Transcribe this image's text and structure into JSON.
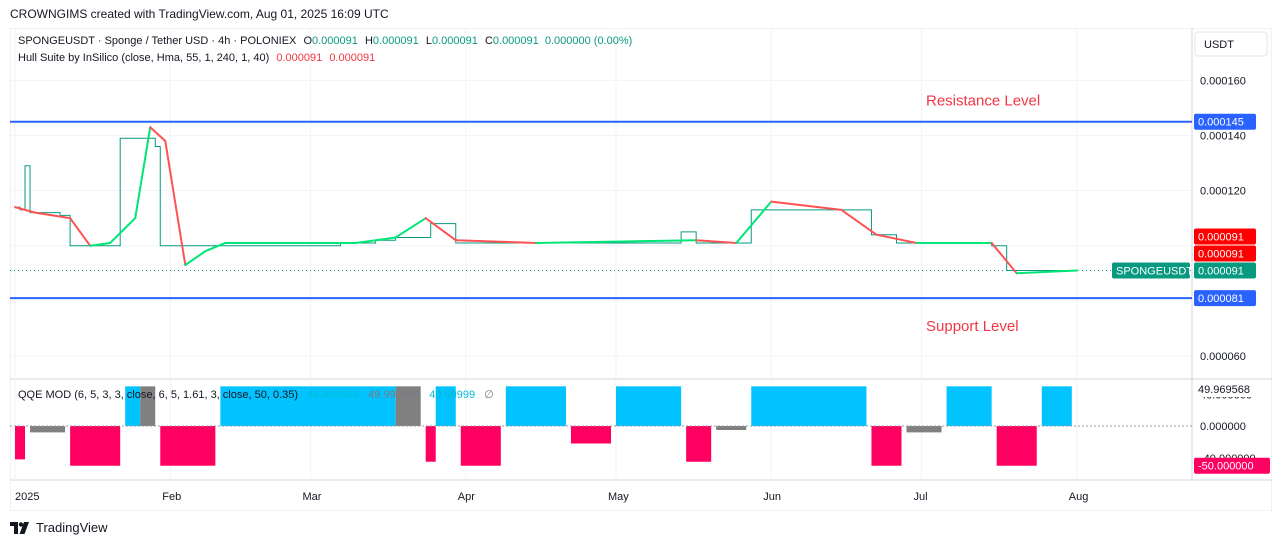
{
  "header": {
    "title": "CROWNGIMS created with TradingView.com, Aug 01, 2025 16:09 UTC"
  },
  "symbol_legend": {
    "name": "SPONGEUSDT · Sponge / Tether USD · 4h · POLONIEX",
    "o_label": "O",
    "o_value": "0.000091",
    "h_label": "H",
    "h_value": "0.000091",
    "l_label": "L",
    "l_value": "0.000091",
    "c_label": "C",
    "c_value": "0.000091",
    "change": "0.000000 (0.00%)"
  },
  "hull_legend": {
    "name": "Hull Suite by InSilico (close, Hma, 55, 1, 240, 1, 40)",
    "v1": "0.000091",
    "v2": "0.000091"
  },
  "qqe_legend": {
    "name": "QQE MOD (6, 5, 3, 3, close, 6, 5, 1.61, 3, close, 50, 0.35)",
    "v1": "49.969568",
    "v2": "49.999994",
    "v3": "49.99999",
    "v4": "∅"
  },
  "annotations": {
    "resistance": "Resistance Level",
    "support": "Support Level"
  },
  "price_axis": {
    "currency": "USDT",
    "ticks": [
      "0.000160",
      "0.000140",
      "0.000120",
      "0.000060"
    ],
    "resistance_label": "0.000145",
    "support_label": "0.000081",
    "hull_label_1": "0.000091",
    "hull_label_2": "0.000091",
    "symbol_tag": "SPONGEUSDT",
    "last_price": "0.000091"
  },
  "qqe_axis": {
    "ticks": [
      "40.000000",
      "0.000000",
      "-40.000000"
    ],
    "top_label": "49.969568",
    "bottom_label": "-50.000000"
  },
  "time_axis": [
    "2025",
    "Feb",
    "Mar",
    "Apr",
    "May",
    "Jun",
    "Jul",
    "Aug"
  ],
  "footer": {
    "brand": "TradingView"
  },
  "colors": {
    "line_blue": "#2962ff",
    "up": "#089981",
    "hull_green": "#00e676",
    "hull_red": "#ff5252",
    "qqe_blue": "#00c3ff",
    "qqe_red": "#ff0062",
    "qqe_gray": "#808080",
    "annotation": "#f23645"
  },
  "chart_data": {
    "type": "line",
    "title": "SPONGEUSDT · Sponge / Tether USD · 4h · POLONIEX",
    "ylabel": "USDT",
    "ylim": [
      5.2e-05,
      0.000179
    ],
    "resistance": 0.000145,
    "support": 8.1e-05,
    "last_price": 9.1e-05,
    "price_series": [
      [
        "2025-01-01",
        0.000114
      ],
      [
        "2025-01-02",
        0.000113
      ],
      [
        "2025-01-03",
        0.000129
      ],
      [
        "2025-01-04",
        0.000112
      ],
      [
        "2025-01-10",
        0.000111
      ],
      [
        "2025-01-12",
        0.0001
      ],
      [
        "2025-01-20",
        0.0001
      ],
      [
        "2025-01-22",
        0.000136
      ],
      [
        "2025-01-22",
        0.000139
      ],
      [
        "2025-01-29",
        0.000136
      ],
      [
        "2025-01-30",
        0.0001
      ],
      [
        "2025-02-10",
        0.0001
      ],
      [
        "2025-02-20",
        0.0001
      ],
      [
        "2025-03-04",
        0.0001
      ],
      [
        "2025-03-07",
        0.000101
      ],
      [
        "2025-03-14",
        0.000102
      ],
      [
        "2025-03-18",
        0.000103
      ],
      [
        "2025-03-25",
        0.000108
      ],
      [
        "2025-03-30",
        0.000101
      ],
      [
        "2025-04-15",
        0.000101
      ],
      [
        "2025-05-01",
        0.000101
      ],
      [
        "2025-05-14",
        0.000105
      ],
      [
        "2025-05-17",
        0.000101
      ],
      [
        "2025-05-20",
        0.000101
      ],
      [
        "2025-05-28",
        0.000113
      ],
      [
        "2025-06-05",
        0.000113
      ],
      [
        "2025-06-15",
        0.000113
      ],
      [
        "2025-06-21",
        0.000104
      ],
      [
        "2025-06-26",
        0.000101
      ],
      [
        "2025-07-04",
        0.000101
      ],
      [
        "2025-07-15",
        0.0001
      ],
      [
        "2025-07-18",
        9.1e-05
      ],
      [
        "2025-08-01",
        9.1e-05
      ]
    ],
    "hull_series": [
      [
        "2025-01-01",
        0.000114
      ],
      [
        "2025-01-05",
        0.000112
      ],
      [
        "2025-01-12",
        0.00011
      ],
      [
        "2025-01-16",
        0.0001
      ],
      [
        "2025-01-20",
        0.000101
      ],
      [
        "2025-01-25",
        0.00011
      ],
      [
        "2025-01-28",
        0.000143
      ],
      [
        "2025-01-31",
        0.000138
      ],
      [
        "2025-02-04",
        9.3e-05
      ],
      [
        "2025-02-08",
        9.8e-05
      ],
      [
        "2025-02-12",
        0.000101
      ],
      [
        "2025-03-10",
        0.000101
      ],
      [
        "2025-03-18",
        0.000103
      ],
      [
        "2025-03-24",
        0.00011
      ],
      [
        "2025-03-30",
        0.000102
      ],
      [
        "2025-04-15",
        0.000101
      ],
      [
        "2025-05-17",
        0.000102
      ],
      [
        "2025-05-25",
        0.000101
      ],
      [
        "2025-06-01",
        0.000116
      ],
      [
        "2025-06-15",
        0.000113
      ],
      [
        "2025-06-22",
        0.000104
      ],
      [
        "2025-06-30",
        0.000101
      ],
      [
        "2025-07-15",
        0.000101
      ],
      [
        "2025-07-20",
        9e-05
      ],
      [
        "2025-08-01",
        9.1e-05
      ]
    ],
    "qqe": {
      "ylim": [
        -68,
        58
      ],
      "thresholds": [
        40,
        0,
        -40
      ],
      "segments": [
        {
          "from": "2025-01-01",
          "to": "2025-01-03",
          "color": "red",
          "value": -42
        },
        {
          "from": "2025-01-04",
          "to": "2025-01-11",
          "color": "gray",
          "value": -8
        },
        {
          "from": "2025-01-12",
          "to": "2025-01-22",
          "color": "red",
          "value": -50
        },
        {
          "from": "2025-01-23",
          "to": "2025-01-26",
          "color": "blue",
          "value": 50
        },
        {
          "from": "2025-01-26",
          "to": "2025-01-29",
          "color": "gray",
          "value": 50
        },
        {
          "from": "2025-01-30",
          "to": "2025-02-10",
          "color": "red",
          "value": -50
        },
        {
          "from": "2025-02-11",
          "to": "2025-03-18",
          "color": "blue",
          "value": 50
        },
        {
          "from": "2025-03-18",
          "to": "2025-03-23",
          "color": "gray",
          "value": 50
        },
        {
          "from": "2025-03-24",
          "to": "2025-03-26",
          "color": "red",
          "value": -45
        },
        {
          "from": "2025-03-26",
          "to": "2025-03-30",
          "color": "blue",
          "value": 50
        },
        {
          "from": "2025-03-31",
          "to": "2025-04-08",
          "color": "red",
          "value": -50
        },
        {
          "from": "2025-04-09",
          "to": "2025-04-21",
          "color": "blue",
          "value": 50
        },
        {
          "from": "2025-04-22",
          "to": "2025-04-30",
          "color": "red",
          "value": -22
        },
        {
          "from": "2025-05-01",
          "to": "2025-05-14",
          "color": "blue",
          "value": 50
        },
        {
          "from": "2025-05-15",
          "to": "2025-05-20",
          "color": "red",
          "value": -45
        },
        {
          "from": "2025-05-21",
          "to": "2025-05-27",
          "color": "gray",
          "value": -5
        },
        {
          "from": "2025-05-28",
          "to": "2025-06-20",
          "color": "blue",
          "value": 50
        },
        {
          "from": "2025-06-21",
          "to": "2025-06-27",
          "color": "red",
          "value": -50
        },
        {
          "from": "2025-06-28",
          "to": "2025-07-05",
          "color": "gray",
          "value": -8
        },
        {
          "from": "2025-07-06",
          "to": "2025-07-15",
          "color": "blue",
          "value": 50
        },
        {
          "from": "2025-07-16",
          "to": "2025-07-24",
          "color": "red",
          "value": -50
        },
        {
          "from": "2025-07-25",
          "to": "2025-07-31",
          "color": "blue",
          "value": 50
        }
      ]
    }
  }
}
